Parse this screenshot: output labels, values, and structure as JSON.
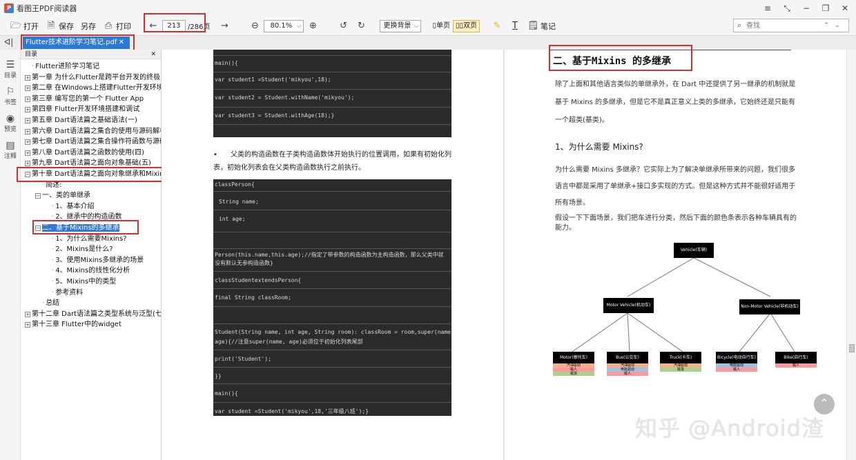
{
  "app": {
    "title": "看图王PDF阅读器"
  },
  "window_controls": [
    "≡",
    "⤡",
    "−",
    "❐",
    "✕"
  ],
  "toolbar": {
    "open": "打开",
    "save": "保存",
    "save_as": "另存",
    "print": "打印",
    "current_page": "213",
    "total_pages": "/286页",
    "zoom": "80.1%",
    "background": "更换背景",
    "single_page": "单页",
    "double_page": "双页",
    "notes": "笔记",
    "search_placeholder": "查找"
  },
  "tab": {
    "title": "Flutter技术进阶学习笔记.pdf",
    "close": "✕"
  },
  "rail": [
    {
      "label": "目录"
    },
    {
      "label": "书签"
    },
    {
      "label": "预览"
    },
    {
      "label": "注释"
    }
  ],
  "toc": {
    "header": "目录",
    "items": [
      {
        "label": "Flutter进阶学习笔记"
      },
      {
        "label": "第一章 为什么Flutter是跨平台开发的终极之选"
      },
      {
        "label": "第二章 在Windows上搭建Flutter开发环境"
      },
      {
        "label": "第三章 编写您的第一个 Flutter App"
      },
      {
        "label": "第四章 Flutter开发环境搭建和调试"
      },
      {
        "label": "第五章 Dart语法篇之基础语法(一)"
      },
      {
        "label": "第六章 Dart语法篇之集合的使用与源码解析("
      },
      {
        "label": "第七章 Dart语法篇之集合操作符函数与源码分"
      },
      {
        "label": "第八章 Dart语法篇之函数的使用(四)"
      },
      {
        "label": "第九章 Dart语法篇之面向对象基础(五)"
      },
      {
        "label": "第十章 Dart语法篇之面向对象继承和Mixins("
      },
      {
        "label": "简述:"
      },
      {
        "label": "一、类的单继承"
      },
      {
        "label": "1、基本介绍"
      },
      {
        "label": "2、继承中的构造函数"
      },
      {
        "label": "二、基于Mixins的多继承"
      },
      {
        "label": "1、为什么需要Mixins?"
      },
      {
        "label": "2、Mixins是什么?"
      },
      {
        "label": "3、使用Mixins多继承的场景"
      },
      {
        "label": "4、Mixins的线性化分析"
      },
      {
        "label": "5、Mixins中的类型"
      },
      {
        "label": "参考资料"
      },
      {
        "label": "总结"
      },
      {
        "label": "第十二章 Dart语法篇之类型系统与泛型(七)"
      },
      {
        "label": "第十三章 Flutter中的widget"
      }
    ]
  },
  "left_page": {
    "code1": [
      "main(){",
      "var student1 =Student('mikyou',18);",
      "var student2 = Student.withName('mikyou');",
      "var student3 = Student.withAge(18);}"
    ],
    "bullet": "父类的构造函数在子类构造函数体开始执行的位置调用，如果有初始化列表，初始化列表会在父类构造函数执行之前执行。",
    "code2": [
      "classPerson{",
      "String name;",
      "int age;",
      "Person(this.name,this.age);//指定了带参数的构造函数为主构造函数，那么父类中就",
      "没有默认无参构造函数}",
      "classStudentextendsPerson{",
      "final String classRoom;",
      "Student(String name, int age, String room): classRoom = room,super(name,",
      "age){//注意super(name, age)必须位于初始化列表尾部",
      "print('Student');",
      "}}",
      "main(){",
      "var student =Student('mikyou',18,'三年级八班');}"
    ]
  },
  "right_page": {
    "heading": "二、基于Mixins 的多继承",
    "intro": "除了上面和其他语言类似的单继承外，在 Dart 中还提供了另一继承的机制就是基于 Mixins 的多继承，但是它不是真正意义上类的多继承，它始终还是只能有一个超类(基类)。",
    "subheading": "1、为什么需要 Mixins?",
    "para2": "为什么需要 Mixins 多继承？它实际上为了解决单继承所带来的问题，我们很多语言中都是采用了单继承+接口多实现的方式。但是这种方式并不能很好适用于所有场景。",
    "para3": "假设一下下面场景，我们把车进行分类，然后下面的颜色条表示各种车辆具有的能力。",
    "diagram": {
      "root": "Vehicle(车辆)",
      "motor": "Motor Vehicle(机动车)",
      "nonmotor": "Non-Motor Vehicle(非机动车)",
      "leaves": [
        {
          "label": "Motor(摩托车)",
          "chips": [
            "汽油驱动",
            "载人",
            "载货"
          ]
        },
        {
          "label": "Bus(公交车)",
          "chips": [
            "汽油驱动",
            "电能驱动",
            "载人"
          ]
        },
        {
          "label": "Truck(卡车)",
          "chips": [
            "汽油驱动",
            "载货"
          ]
        },
        {
          "label": "Bicycle(电动自行车)",
          "chips": [
            "电能驱动",
            "载人"
          ]
        },
        {
          "label": "Bike(自行车)",
          "chips": [
            "载人"
          ]
        }
      ],
      "chip_colors": {
        "汽油驱动": "#f4b183",
        "电能驱动": "#9dc3e6",
        "载人": "#ff9999",
        "载货": "#a9d18e"
      }
    }
  },
  "watermark": "知乎 @Android渣"
}
